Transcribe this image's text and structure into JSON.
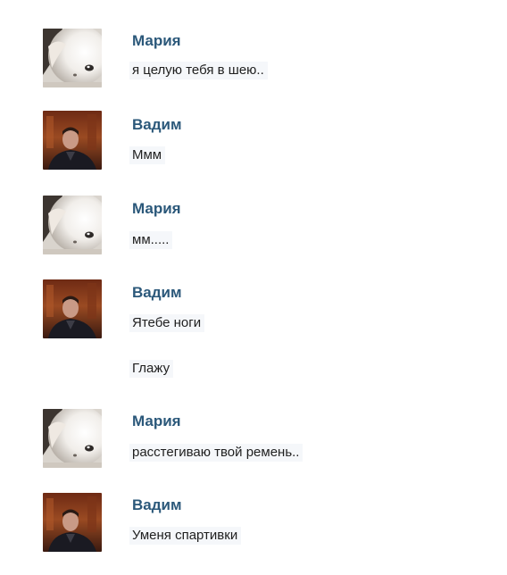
{
  "messages": [
    {
      "author": "Мария",
      "avatar": "maria-avatar",
      "text": "я целую тебя в шею.."
    },
    {
      "author": "Вадим",
      "avatar": "vadim-avatar",
      "text": "Ммм"
    },
    {
      "author": "Мария",
      "avatar": "maria-avatar",
      "text": "мм....."
    },
    {
      "author": "Вадим",
      "avatar": "vadim-avatar",
      "text": "Ятебе ноги",
      "continuation": "Глажу"
    },
    {
      "author": "Мария",
      "avatar": "maria-avatar",
      "text": "расстегиваю твой ремень.."
    },
    {
      "author": "Вадим",
      "avatar": "vadim-avatar",
      "text": "Уменя спартивки"
    }
  ]
}
